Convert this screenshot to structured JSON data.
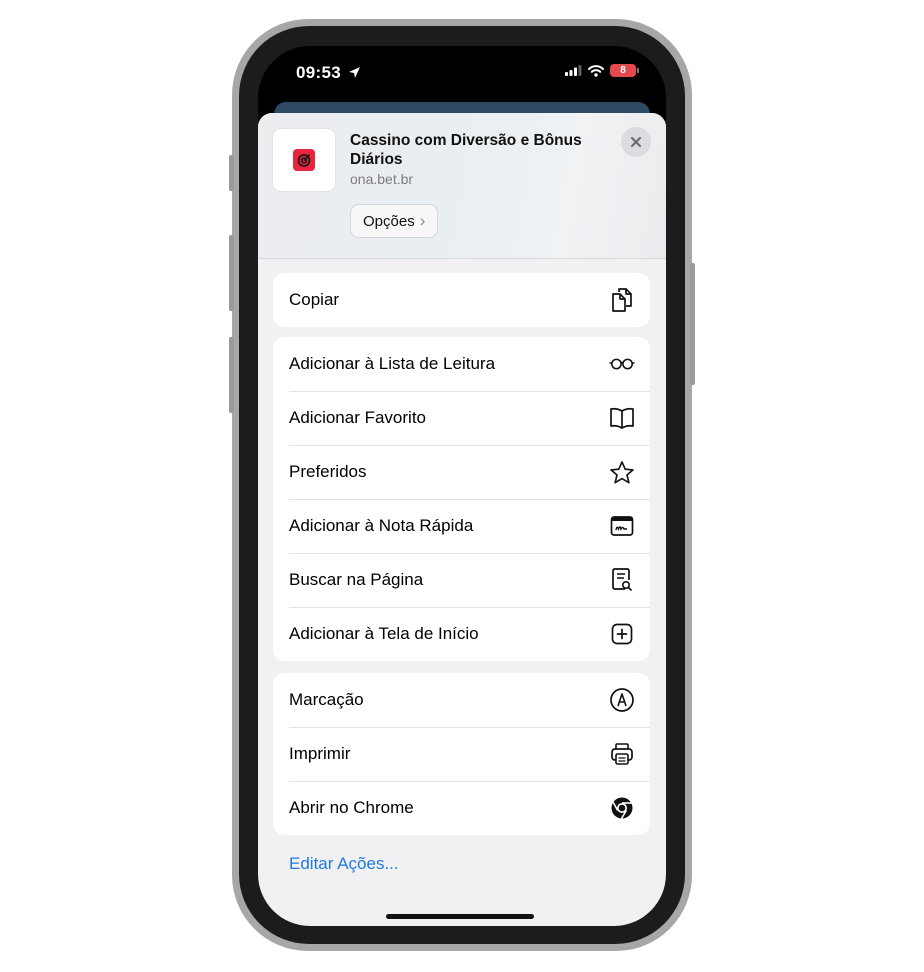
{
  "status_bar": {
    "time": "09:53",
    "battery": "8"
  },
  "share_sheet": {
    "header": {
      "title": "Cassino com Diversão e Bônus Diários",
      "domain": "ona.bet.br",
      "options_label": "Opções",
      "options_chevron": "›"
    },
    "groups": [
      {
        "items": [
          {
            "label": "Copiar",
            "icon": "copy-icon"
          }
        ]
      },
      {
        "items": [
          {
            "label": "Adicionar à Lista de Leitura",
            "icon": "glasses-icon"
          },
          {
            "label": "Adicionar Favorito",
            "icon": "book-icon"
          },
          {
            "label": "Preferidos",
            "icon": "star-icon"
          },
          {
            "label": "Adicionar à Nota Rápida",
            "icon": "quick-note-icon"
          },
          {
            "label": "Buscar na Página",
            "icon": "find-on-page-icon"
          },
          {
            "label": "Adicionar à Tela de Início",
            "icon": "add-square-icon"
          }
        ]
      },
      {
        "items": [
          {
            "label": "Marcação",
            "icon": "markup-icon"
          },
          {
            "label": "Imprimir",
            "icon": "printer-icon"
          },
          {
            "label": "Abrir no Chrome",
            "icon": "chrome-icon"
          }
        ]
      }
    ],
    "edit_actions": "Editar Ações..."
  },
  "colors": {
    "accent": "#1f7ae0",
    "sheet_background": "#f1f1f3",
    "logo_red": "#e8253a"
  }
}
